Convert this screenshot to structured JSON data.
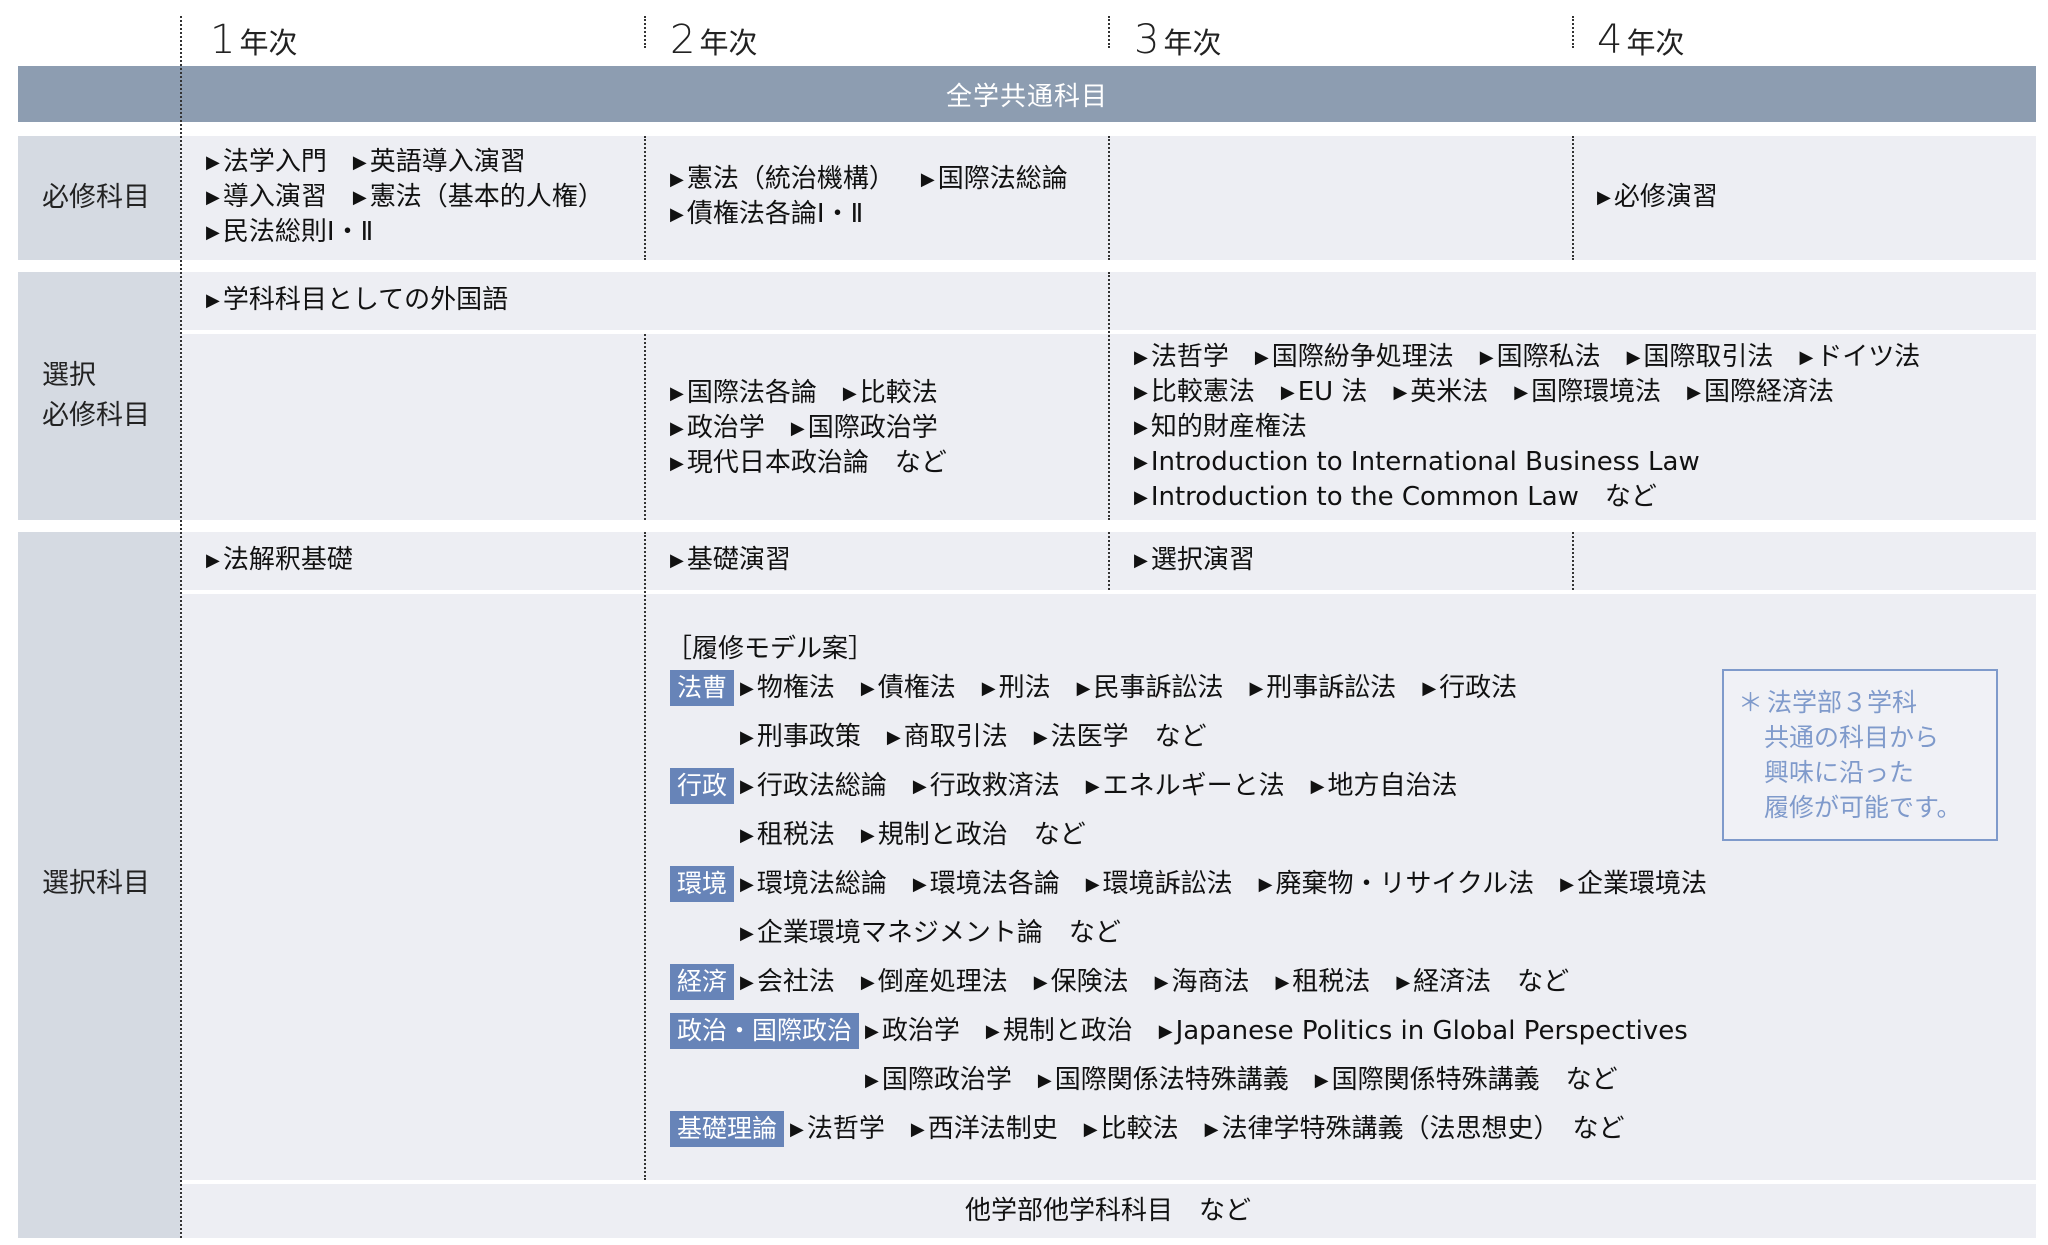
{
  "years": [
    "年次",
    "年次",
    "年次",
    "年次"
  ],
  "year_nums": [
    "1",
    "2",
    "3",
    "4"
  ],
  "band": "全学共通科目",
  "categories": {
    "required": "必修科目",
    "selective_required_1": "選択",
    "selective_required_2": "必修科目",
    "elective": "選択科目"
  },
  "required": {
    "y1": [
      [
        "法学入門",
        "英語導入演習"
      ],
      [
        "導入演習",
        "憲法（基本的人権）"
      ],
      [
        "民法総則Ⅰ・Ⅱ"
      ]
    ],
    "y2": [
      [
        "憲法（統治機構）",
        "国際法総論"
      ],
      [
        "債権法各論Ⅰ・Ⅱ"
      ]
    ],
    "y4": [
      [
        "必修演習"
      ]
    ]
  },
  "selective_required": {
    "foreign_language": "学科科目としての外国語",
    "y2": [
      [
        "国際法各論",
        "比較法"
      ],
      [
        "政治学",
        "国際政治学"
      ],
      [
        "現代日本政治論　など"
      ]
    ],
    "y34": [
      [
        "法哲学",
        "国際紛争処理法",
        "国際私法",
        "国際取引法",
        "ドイツ法"
      ],
      [
        "比較憲法",
        "EU 法",
        "英米法",
        "国際環境法",
        "国際経済法"
      ],
      [
        "知的財産権法"
      ],
      [
        "Introduction to International  Business Law"
      ],
      [
        "Introduction to the Common Law　など"
      ]
    ]
  },
  "elective": {
    "y1": "法解釈基礎",
    "y2": "基礎演習",
    "y3": "選択演習",
    "model_title": "［履修モデル案］",
    "tracks": [
      {
        "tag": "法曹",
        "lines": [
          [
            "物権法",
            "債権法",
            "刑法",
            "民事訴訟法",
            "刑事訴訟法",
            "行政法"
          ],
          [
            "刑事政策",
            "商取引法",
            "法医学　など"
          ]
        ]
      },
      {
        "tag": "行政",
        "lines": [
          [
            "行政法総論",
            "行政救済法",
            "エネルギーと法",
            "地方自治法"
          ],
          [
            "租税法",
            "規制と政治　など"
          ]
        ]
      },
      {
        "tag": "環境",
        "lines": [
          [
            "環境法総論",
            "環境法各論",
            "環境訴訟法",
            "廃棄物・リサイクル法",
            "企業環境法"
          ],
          [
            "企業環境マネジメント論　など"
          ]
        ]
      },
      {
        "tag": "経済",
        "lines": [
          [
            "会社法",
            "倒産処理法",
            "保険法",
            "海商法",
            "租税法",
            "経済法　など"
          ]
        ]
      },
      {
        "tag": "政治・国際政治",
        "lines": [
          [
            "政治学",
            "規制と政治",
            "Japanese Politics in Global Perspectives"
          ],
          [
            "国際政治学",
            "国際関係法特殊講義",
            "国際関係特殊講義　など"
          ]
        ]
      },
      {
        "tag": "基礎理論",
        "lines": [
          [
            "法哲学",
            "西洋法制史",
            "比較法",
            "法律学特殊講義（法思想史）　など"
          ]
        ]
      }
    ],
    "note": [
      "法学部３学科",
      "共通の科目から",
      "興味に沿った",
      "履修が可能です。"
    ],
    "note_star": "＊",
    "other": "他学部他学科科目　など"
  },
  "colors": {
    "band": "#8d9db1",
    "category": "#d5dae2",
    "cell": "#edeef3",
    "tag": "#6784b8",
    "note": "#7f9acb"
  },
  "icons": {
    "bullet": "right-triangle-icon"
  }
}
